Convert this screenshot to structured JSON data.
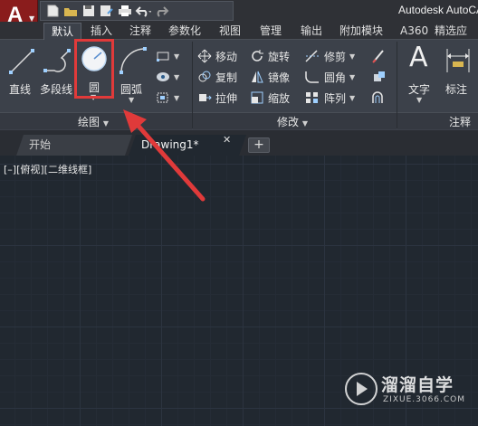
{
  "app": {
    "logo_letter": "A",
    "title": "Autodesk AutoCAD"
  },
  "quick_access": {
    "icons": [
      "new-file-icon",
      "open-folder-icon",
      "save-icon",
      "save-as-icon",
      "print-icon",
      "undo-icon",
      "redo-icon"
    ]
  },
  "ribbon_tabs": [
    "默认",
    "插入",
    "注释",
    "参数化",
    "视图",
    "管理",
    "输出",
    "附加模块",
    "A360",
    "精选应用"
  ],
  "active_tab": "默认",
  "draw_panel": {
    "title": "绘图",
    "line_label": "直线",
    "polyline_label": "多段线",
    "circle_label": "圆",
    "arc_label": "圆弧"
  },
  "modify_panel": {
    "title": "修改",
    "move_label": "移动",
    "copy_label": "复制",
    "stretch_label": "拉伸",
    "rotate_label": "旋转",
    "mirror_label": "镜像",
    "scale_label": "缩放",
    "trim_label": "修剪",
    "fillet_label": "圆角",
    "array_label": "阵列"
  },
  "annotation_panel": {
    "title": "注释",
    "text_label": "文字",
    "dimension_label": "标注"
  },
  "file_tabs": {
    "start_label": "开始",
    "drawing_label": "Drawing1*",
    "close_glyph": "✕",
    "new_glyph": "+"
  },
  "viewport": {
    "label": "[–][俯视][二维线框]"
  },
  "watermark": {
    "title": "溜溜自学",
    "url": "ZIXUE.3066.COM"
  },
  "colors": {
    "accent_red": "#e03a3a",
    "canvas_bg": "#212830",
    "ribbon_bg": "#3c414a"
  }
}
